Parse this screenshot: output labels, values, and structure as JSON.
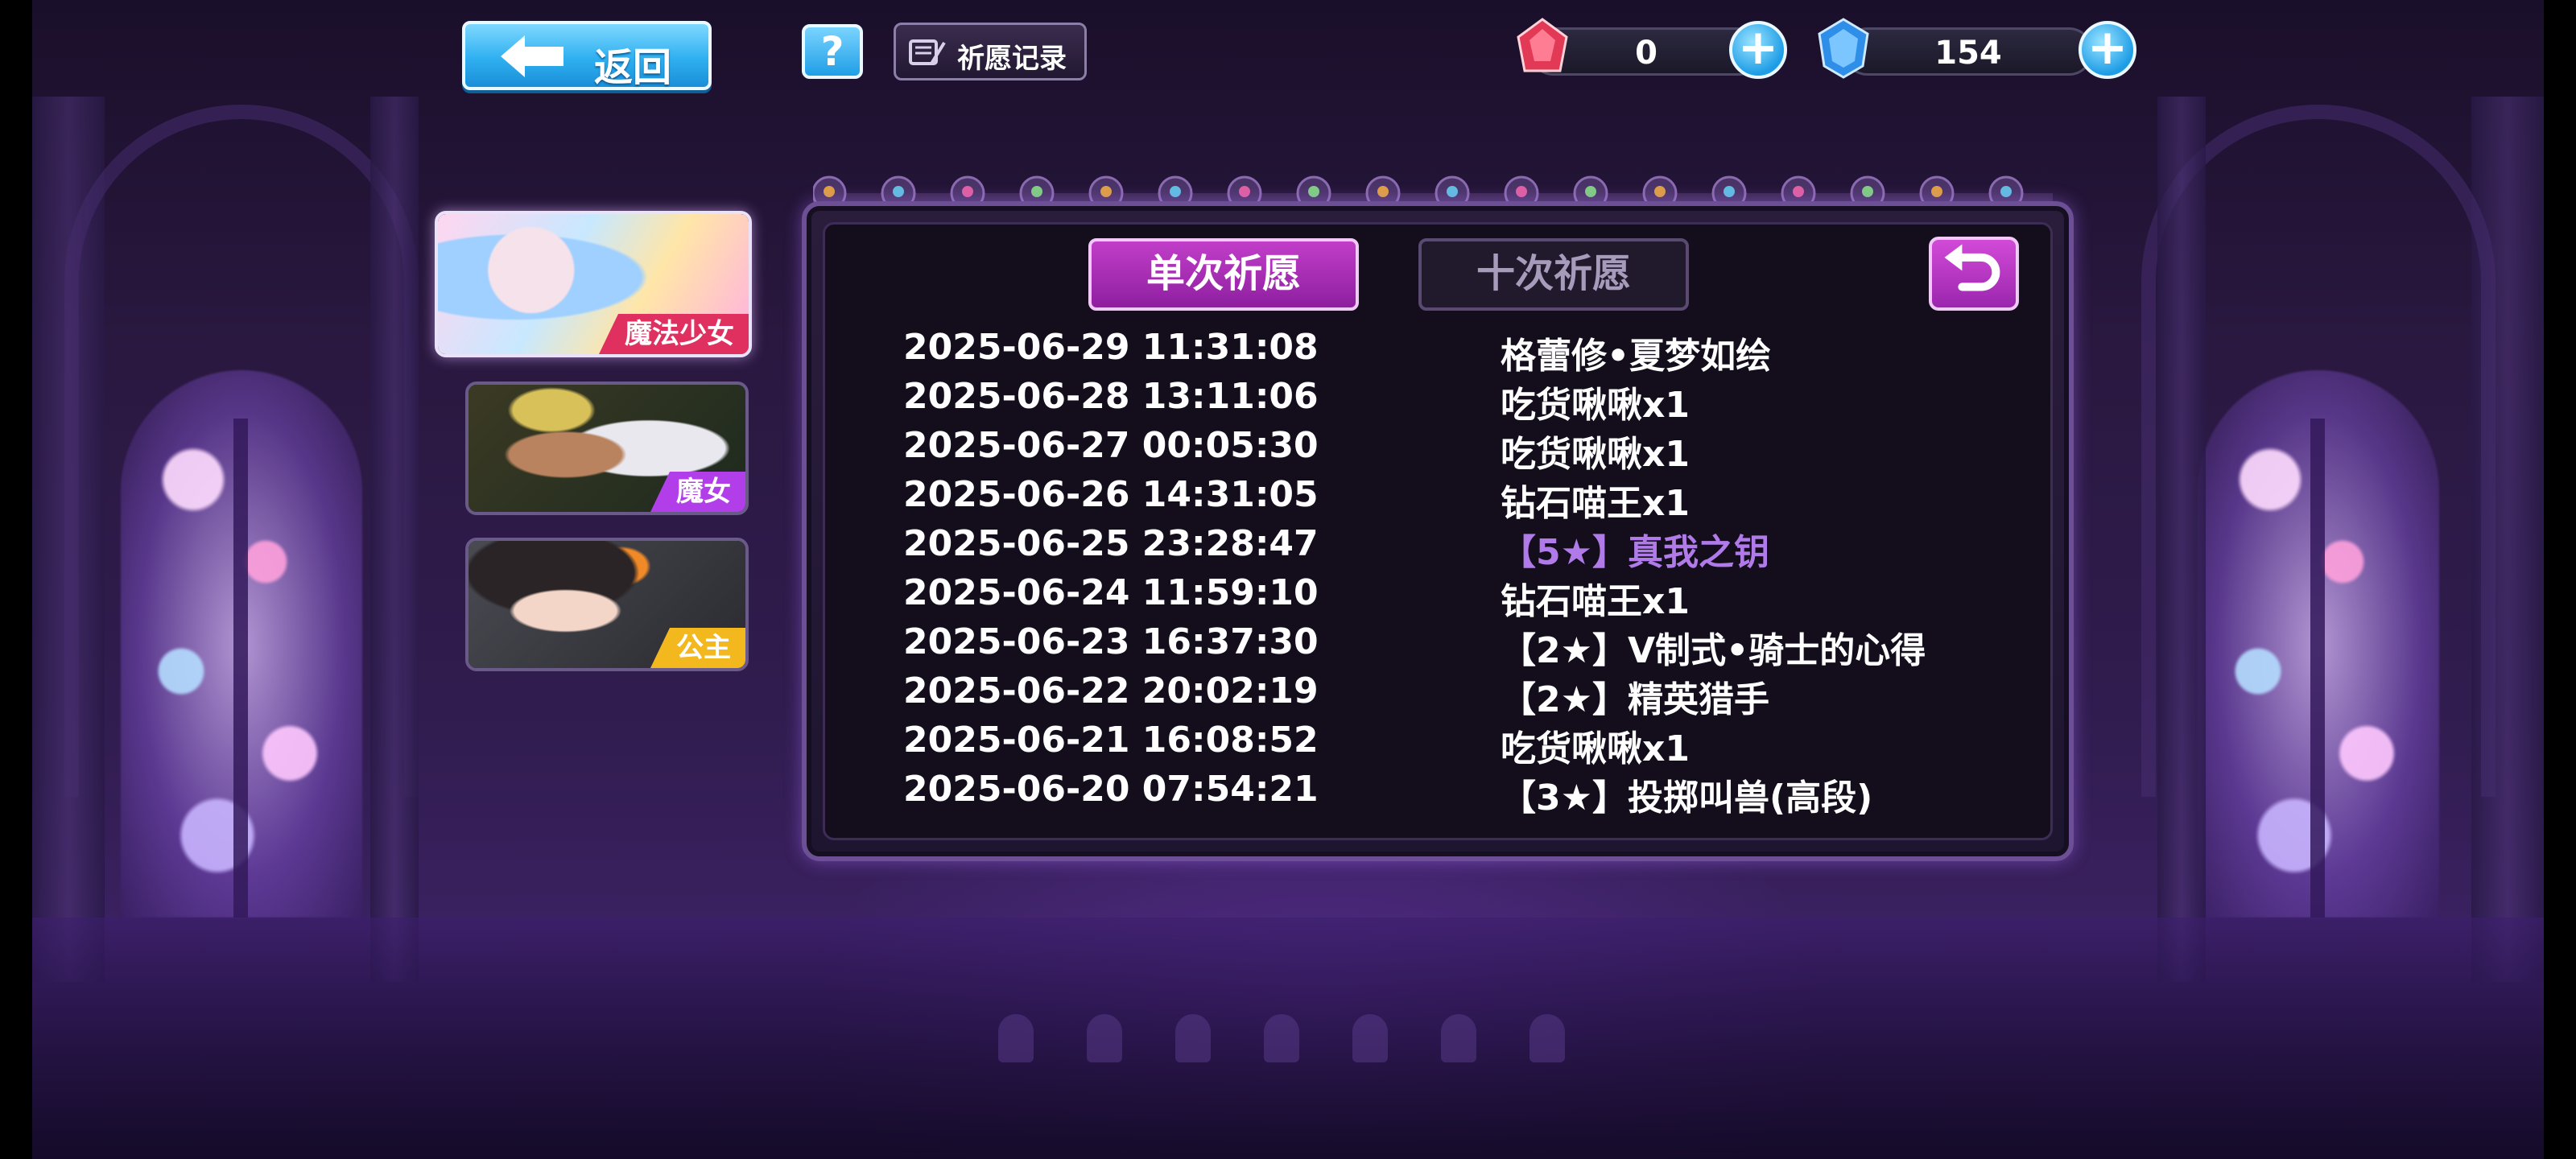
{
  "top_bar": {
    "back_label": "返回",
    "help_label": "?",
    "history_label": "祈愿记录",
    "currencies": [
      {
        "icon": "ruby-icon",
        "value": "0"
      },
      {
        "icon": "diamond-icon",
        "value": "154"
      }
    ],
    "plus_label": "+"
  },
  "side_cards": [
    {
      "label": "魔法少女",
      "active": true,
      "tag_color": "#e0305f"
    },
    {
      "label": "魔女",
      "active": false,
      "tag_color": "#b13ee8"
    },
    {
      "label": "公主",
      "active": false,
      "tag_color": "#f2b81e"
    }
  ],
  "panel": {
    "tabs": [
      {
        "label": "单次祈愿",
        "active": true
      },
      {
        "label": "十次祈愿",
        "active": false
      }
    ],
    "records": [
      {
        "time": "2025-06-29 11:31:08",
        "item": "格蕾修•夏梦如绘",
        "rarity": ""
      },
      {
        "time": "2025-06-28 13:11:06",
        "item": "吃货啾啾x1",
        "rarity": ""
      },
      {
        "time": "2025-06-27 00:05:30",
        "item": "吃货啾啾x1",
        "rarity": ""
      },
      {
        "time": "2025-06-26 14:31:05",
        "item": "钻石喵王x1",
        "rarity": ""
      },
      {
        "time": "2025-06-25 23:28:47",
        "item": "【5★】真我之钥",
        "rarity": "5"
      },
      {
        "time": "2025-06-24 11:59:10",
        "item": "钻石喵王x1",
        "rarity": ""
      },
      {
        "time": "2025-06-23 16:37:30",
        "item": "【2★】V制式•骑士的心得",
        "rarity": "2"
      },
      {
        "time": "2025-06-22 20:02:19",
        "item": "【2★】精英猎手",
        "rarity": "2"
      },
      {
        "time": "2025-06-21 16:08:52",
        "item": "吃货啾啾x1",
        "rarity": ""
      },
      {
        "time": "2025-06-20 07:54:21",
        "item": "【3★】投掷叫兽(高段)",
        "rarity": "3"
      }
    ]
  },
  "colors": {
    "accent_magenta": "#b530bf",
    "button_blue": "#2fb0f0",
    "rarity_5": "#b07be8"
  }
}
